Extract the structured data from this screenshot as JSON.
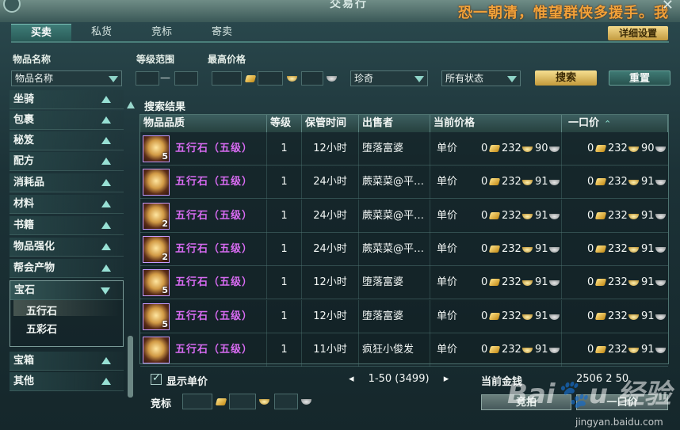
{
  "window": {
    "title": "交易行",
    "banner": "恐一朝清，惟望群侠多援手。我"
  },
  "tabs": [
    "买卖",
    "私货",
    "竞标",
    "寄卖"
  ],
  "detail_button": "详细设置",
  "filters": {
    "item_name_label": "物品名称",
    "item_name_value": "物品名称",
    "level_range_label": "等级范围",
    "level_dash": "—",
    "max_price_label": "最高价格",
    "quality_select": "珍奇",
    "status_select": "所有状态",
    "search_button": "搜索",
    "reset_button": "重置"
  },
  "sidebar": {
    "categories": [
      "坐骑",
      "包裹",
      "秘笈",
      "配方",
      "消耗品",
      "材料",
      "书籍",
      "物品强化",
      "帮会产物",
      "宝石"
    ],
    "sub_items": [
      "五行石",
      "五彩石"
    ],
    "categories_after": [
      "宝箱",
      "其他"
    ]
  },
  "results": {
    "label": "搜索结果",
    "headers": [
      "物品品质",
      "等级",
      "保管时间",
      "出售者",
      "当前价格",
      "一口价"
    ],
    "rows": [
      {
        "name": "五行石（五级）",
        "stack": "5",
        "level": "1",
        "time": "12小时",
        "seller": "堕落富婆",
        "unit": "单价",
        "cur_g": "0",
        "cur_s": "232",
        "cur_c": "90",
        "buy_g": "0",
        "buy_s": "232",
        "buy_c": "90"
      },
      {
        "name": "五行石（五级）",
        "stack": "",
        "level": "1",
        "time": "24小时",
        "seller": "蕨菜菜@平…",
        "unit": "单价",
        "cur_g": "0",
        "cur_s": "232",
        "cur_c": "91",
        "buy_g": "0",
        "buy_s": "232",
        "buy_c": "91"
      },
      {
        "name": "五行石（五级）",
        "stack": "2",
        "level": "1",
        "time": "24小时",
        "seller": "蕨菜菜@平…",
        "unit": "单价",
        "cur_g": "0",
        "cur_s": "232",
        "cur_c": "91",
        "buy_g": "0",
        "buy_s": "232",
        "buy_c": "91"
      },
      {
        "name": "五行石（五级）",
        "stack": "2",
        "level": "1",
        "time": "24小时",
        "seller": "蕨菜菜@平…",
        "unit": "单价",
        "cur_g": "0",
        "cur_s": "232",
        "cur_c": "91",
        "buy_g": "0",
        "buy_s": "232",
        "buy_c": "91"
      },
      {
        "name": "五行石（五级）",
        "stack": "5",
        "level": "1",
        "time": "12小时",
        "seller": "堕落富婆",
        "unit": "单价",
        "cur_g": "0",
        "cur_s": "232",
        "cur_c": "91",
        "buy_g": "0",
        "buy_s": "232",
        "buy_c": "91"
      },
      {
        "name": "五行石（五级）",
        "stack": "5",
        "level": "1",
        "time": "12小时",
        "seller": "堕落富婆",
        "unit": "单价",
        "cur_g": "0",
        "cur_s": "232",
        "cur_c": "91",
        "buy_g": "0",
        "buy_s": "232",
        "buy_c": "91"
      },
      {
        "name": "五行石（五级）",
        "stack": "",
        "level": "1",
        "time": "11小时",
        "seller": "疯狂小俊发",
        "unit": "单价",
        "cur_g": "0",
        "cur_s": "232",
        "cur_c": "91",
        "buy_g": "0",
        "buy_s": "232",
        "buy_c": "91"
      }
    ]
  },
  "footer": {
    "show_unit_price": "显示单价",
    "pager_range": "1-50 (3499)",
    "current_money_label": "当前金钱",
    "current_money_value": "2506 2 50",
    "bid_label": "竞标",
    "bid_button": "竞拍",
    "buyout_button": "一口价"
  },
  "watermark": {
    "text": "Baidu 经验",
    "url": "jingyan.baidu.com"
  },
  "colors": {
    "item_name": "#d86bf2",
    "accent_gold": "#f2a23a",
    "panel": "#1c3237"
  }
}
